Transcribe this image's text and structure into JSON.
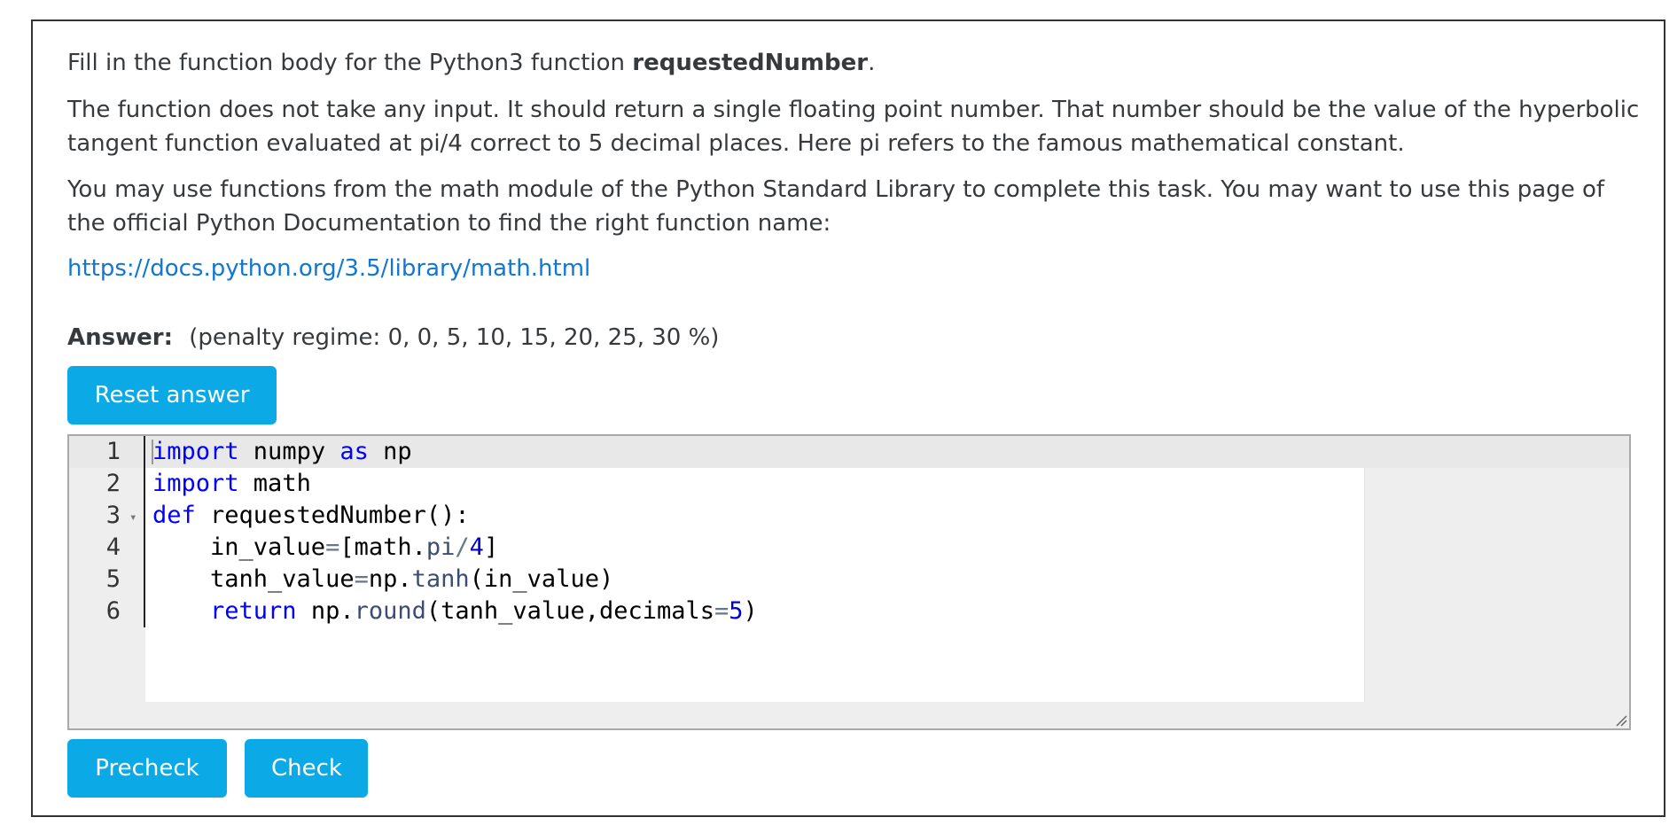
{
  "question": {
    "intro_prefix": "Fill in the function body for the Python3 function ",
    "function_name": "requestedNumber",
    "intro_suffix": ".",
    "description": "The function does not take any input.    It should return a single floating point number.  That number should be the value of the hyperbolic tangent function evaluated at pi/4 correct to 5 decimal places.  Here pi refers to the famous mathematical constant.",
    "library_note": "You may use functions from the math module of the Python Standard Library to complete this task.  You may want to use this page of the official Python Documentation to find the right function name:",
    "doc_link": "https://docs.python.org/3.5/library/math.html"
  },
  "answer": {
    "label": "Answer:",
    "penalty": "(penalty regime: 0, 0, 5, 10, 15, 20, 25, 30 %)",
    "reset_label": "Reset answer"
  },
  "editor": {
    "line_numbers": [
      "1",
      "2",
      "3",
      "4",
      "5",
      "6"
    ],
    "fold_marker": "▾",
    "tokens": {
      "l1_import": "import",
      "l1_rest": " numpy ",
      "l1_as": "as",
      "l1_np": " np",
      "l2_import": "import",
      "l2_rest": " math",
      "l3_def": "def",
      "l3_rest": " requestedNumber():",
      "l4_indent": "    in_value",
      "l4_eq": "=",
      "l4_a": "[math.",
      "l4_pi": "pi",
      "l4_div": "/",
      "l4_num": "4",
      "l4_close": "]",
      "l5_indent": "    tanh_value",
      "l5_eq": "=",
      "l5_np": "np.",
      "l5_tanh": "tanh",
      "l5_rest": "(in_value)",
      "l6_indent": "    ",
      "l6_return": "return",
      "l6_np": " np.",
      "l6_round": "round",
      "l6_args": "(tanh_value,decimals",
      "l6_eq": "=",
      "l6_num": "5",
      "l6_close": ")"
    }
  },
  "buttons": {
    "precheck": "Precheck",
    "check": "Check"
  }
}
